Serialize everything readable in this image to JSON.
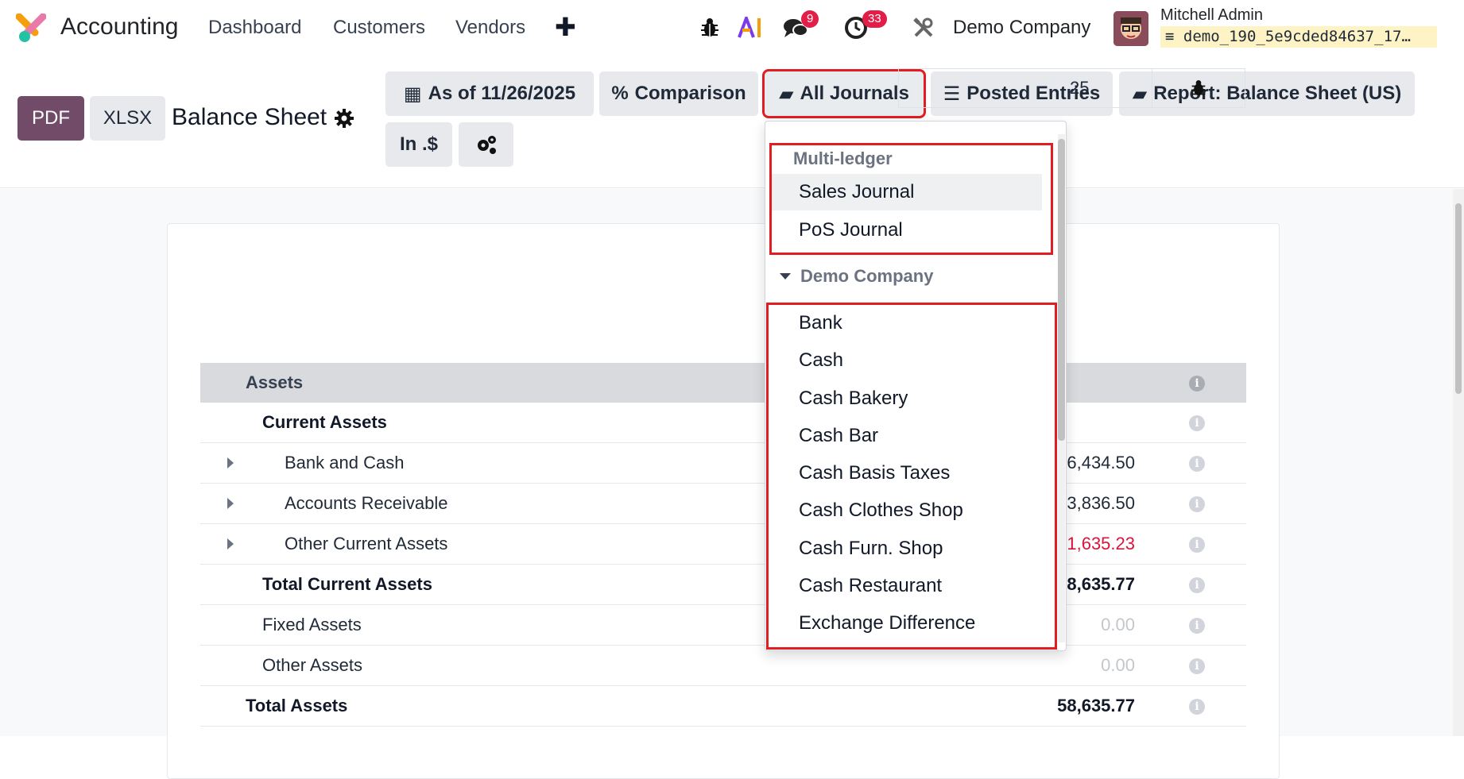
{
  "navbar": {
    "app_name": "Accounting",
    "links": [
      "Dashboard",
      "Customers",
      "Vendors"
    ],
    "plus": "✚",
    "messages_count": "9",
    "activities_count": "33",
    "company": "Demo Company",
    "user_name": "Mitchell Admin",
    "database": "demo_190_5e9cded84637_17…"
  },
  "control_panel": {
    "pdf_label": "PDF",
    "xlsx_label": "XLSX",
    "report_title": "Balance Sheet",
    "filters": {
      "date": "As of 11/26/2025",
      "comparison": "Comparison",
      "journals": "All Journals",
      "entries": "Posted Entries",
      "report": "Report: Balance Sheet (US)",
      "rounding": "In .$"
    }
  },
  "report": {
    "date_column_partial": "25",
    "rows": [
      {
        "label": "Assets",
        "amount": "",
        "style": "header"
      },
      {
        "label": "Current Assets",
        "amount": "",
        "style": "bold"
      },
      {
        "label": "Bank and Cash",
        "amount": "6,434.50",
        "style": "normal",
        "expandable": true
      },
      {
        "label": "Accounts Receivable",
        "amount": "3,836.50",
        "style": "normal",
        "expandable": true
      },
      {
        "label": "Other Current Assets",
        "amount": "1,635.23",
        "style": "negative",
        "expandable": true
      },
      {
        "label": "Total Current Assets",
        "amount": "8,635.77",
        "style": "bold"
      },
      {
        "label": "Fixed Assets",
        "amount": "0.00",
        "style": "muted"
      },
      {
        "label": "Other Assets",
        "amount": "0.00",
        "style": "muted"
      },
      {
        "label": "Total Assets",
        "amount": "58,635.77",
        "style": "total"
      }
    ]
  },
  "journals_dropdown": {
    "multi_ledger_title": "Multi-ledger",
    "multi_ledger_items": [
      "Sales Journal",
      "PoS Journal"
    ],
    "company_group": "Demo Company",
    "company_items": [
      "Bank",
      "Cash",
      "Cash Bakery",
      "Cash Bar",
      "Cash Basis Taxes",
      "Cash Clothes Shop",
      "Cash Furn. Shop",
      "Cash Restaurant",
      "Exchange Difference"
    ]
  },
  "colors": {
    "brand": "#714b67",
    "badge": "#e11d48",
    "highlight": "#e11d22",
    "negative": "#dc143c"
  }
}
